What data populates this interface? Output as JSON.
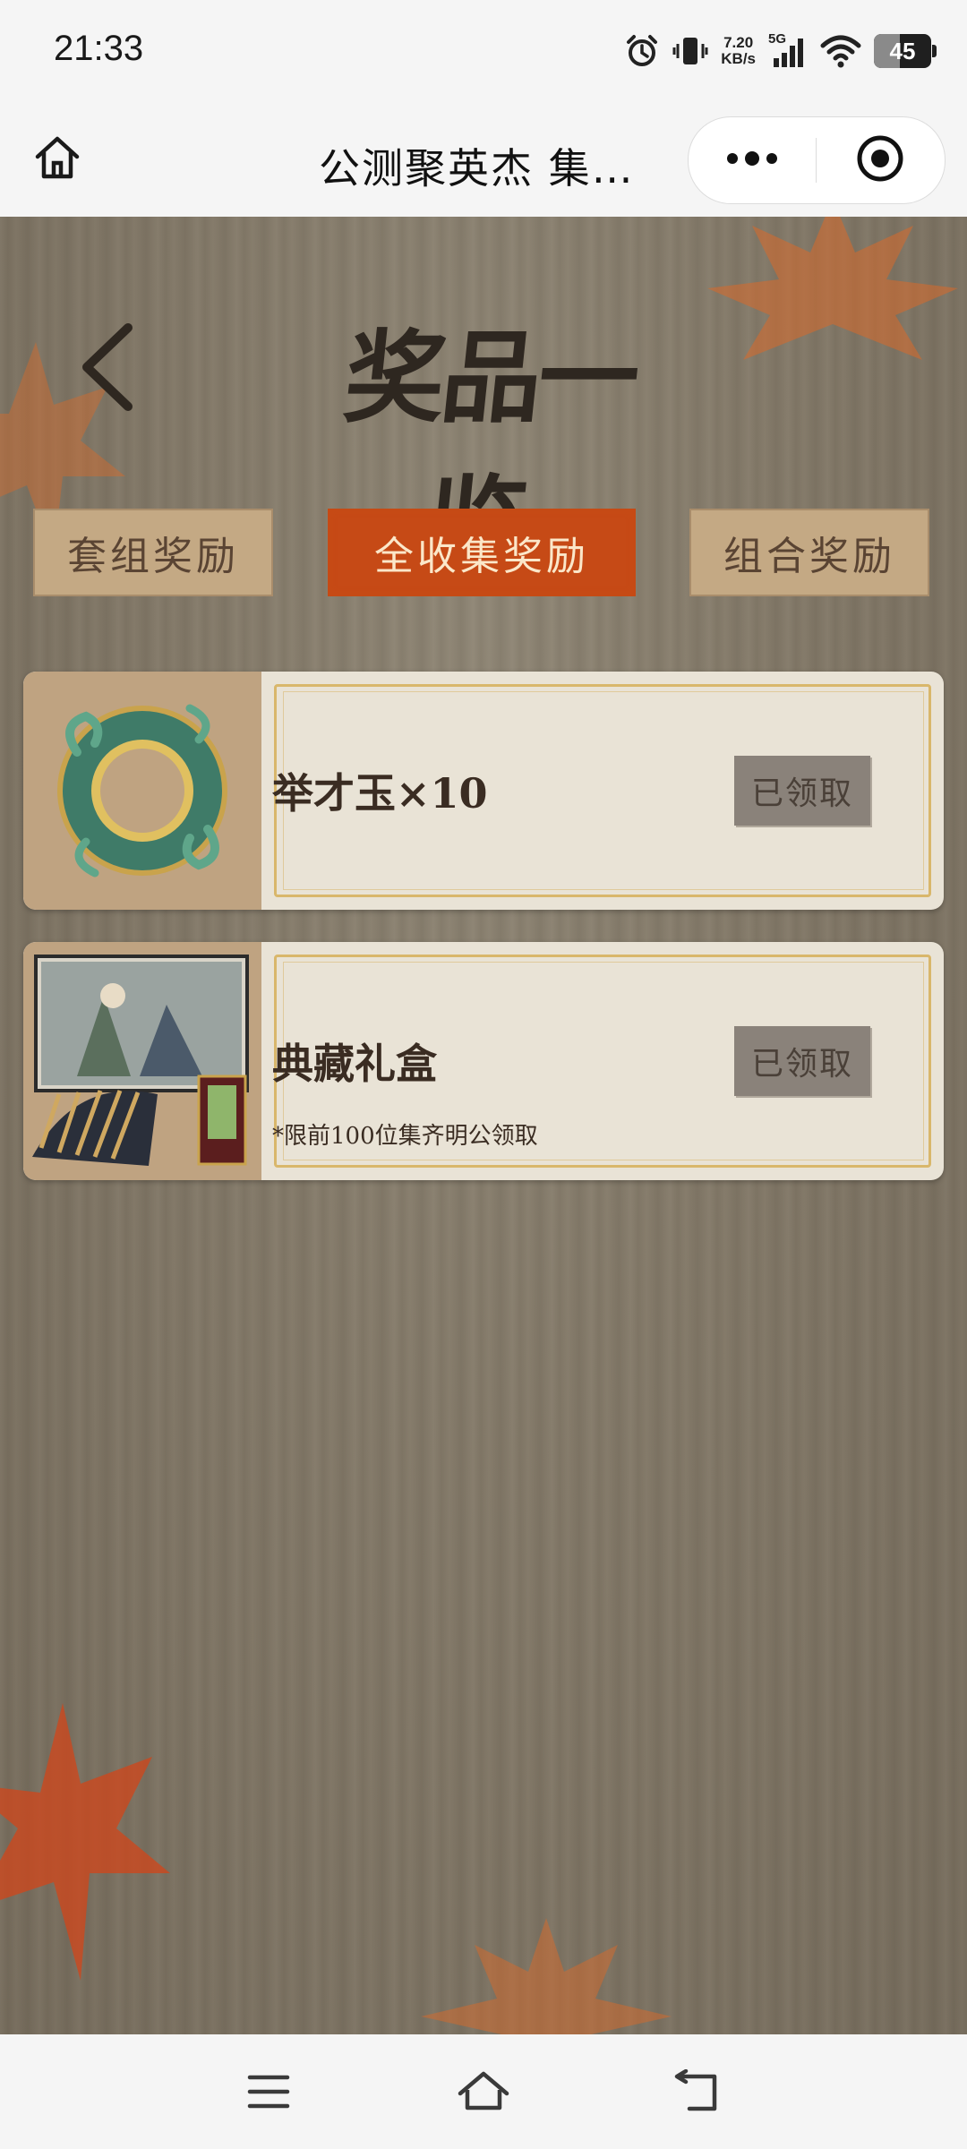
{
  "status_bar": {
    "time": "21:33",
    "net_speed_value": "7.20",
    "net_speed_unit": "KB/s",
    "network_type": "5G",
    "battery_level": "45",
    "battery_fraction": 0.45,
    "icons": [
      "alarm-icon",
      "vibrate-icon",
      "signal-icon",
      "wifi-icon",
      "battery-icon"
    ]
  },
  "nav": {
    "title": "公测聚英杰 集…",
    "home_icon": "home-icon",
    "more_icon": "more-dots-icon",
    "close_icon": "target-close-icon"
  },
  "page": {
    "heading": "奖品一览",
    "back_icon": "back-chevron-icon"
  },
  "tabs": [
    {
      "label": "套组奖励",
      "active": false
    },
    {
      "label": "全收集奖励",
      "active": true
    },
    {
      "label": "组合奖励",
      "active": false
    }
  ],
  "rewards": [
    {
      "name": "举才玉×10",
      "note": "",
      "button": "已领取",
      "image": "jade-disc-image"
    },
    {
      "name": "典藏礼盒",
      "note": "*限前100位集齐明公领取",
      "button": "已领取",
      "image": "collector-gift-box-image"
    }
  ],
  "bottom_nav": {
    "icons": [
      "menu-icon",
      "home-outline-icon",
      "back-arrow-icon"
    ]
  },
  "colors": {
    "active_tab": "#c64a16",
    "inactive_tab": "#c4a984",
    "claimed_button": "#8a827a",
    "card_border": "#d9b76b"
  }
}
